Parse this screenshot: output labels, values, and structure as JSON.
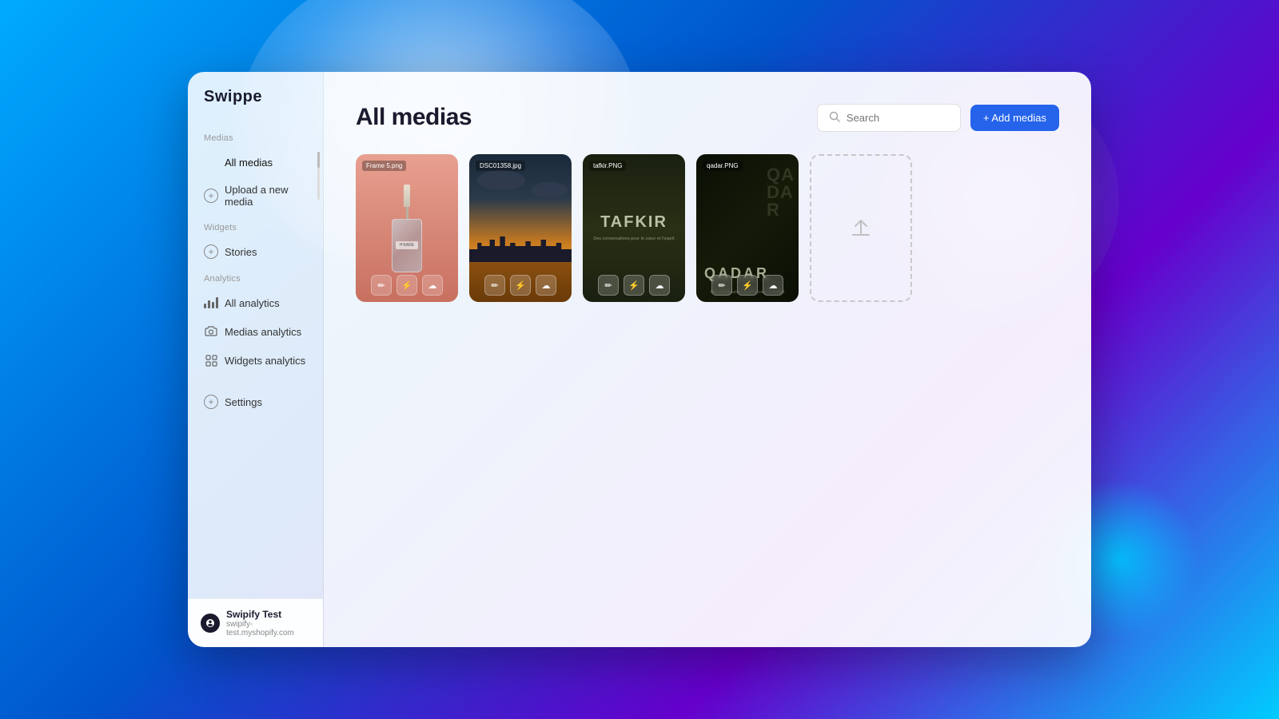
{
  "app": {
    "name": "Swippe"
  },
  "sidebar": {
    "scroll_indicator": true,
    "sections": {
      "medias": {
        "label": "Medias",
        "items": [
          {
            "id": "all-medias",
            "label": "All medias",
            "active": true,
            "icon": "grid"
          },
          {
            "id": "upload-media",
            "label": "Upload a new media",
            "icon": "plus-circle"
          }
        ]
      },
      "widgets": {
        "label": "Widgets",
        "items": [
          {
            "id": "stories",
            "label": "Stories",
            "icon": "plus-circle"
          }
        ]
      },
      "analytics": {
        "label": "Analytics",
        "items": [
          {
            "id": "all-analytics",
            "label": "All analytics",
            "icon": "bar-chart"
          },
          {
            "id": "medics-analytics",
            "label": "Medias analytics",
            "icon": "camera"
          },
          {
            "id": "widgets-analytics",
            "label": "Widgets analytics",
            "icon": "grid-small"
          }
        ]
      }
    },
    "settings": {
      "label": "Settings",
      "icon": "plus-circle"
    },
    "footer": {
      "name": "Swipify Test",
      "url": "swipify-test.myshopify.com",
      "icon": "S"
    }
  },
  "main": {
    "title": "All medias",
    "search": {
      "placeholder": "Search"
    },
    "add_button_label": "+ Add medias",
    "media_cards": [
      {
        "id": "card-1",
        "filename": "Frame 5.png",
        "type": "serum"
      },
      {
        "id": "card-2",
        "filename": "DSC01358.jpg",
        "type": "cityscape"
      },
      {
        "id": "card-3",
        "filename": "tafkir.PNG",
        "type": "text-dark",
        "title": "TAFKIR",
        "subtitle": "Des conversations pour le cœur et l'esprit"
      },
      {
        "id": "card-4",
        "filename": "qadar.PNG",
        "type": "text-dark2",
        "title": "QADAR",
        "overlay": "QA\nDA\nR"
      }
    ],
    "card_actions": {
      "edit": "✏",
      "lightning": "⚡",
      "cloud": "☁"
    }
  }
}
